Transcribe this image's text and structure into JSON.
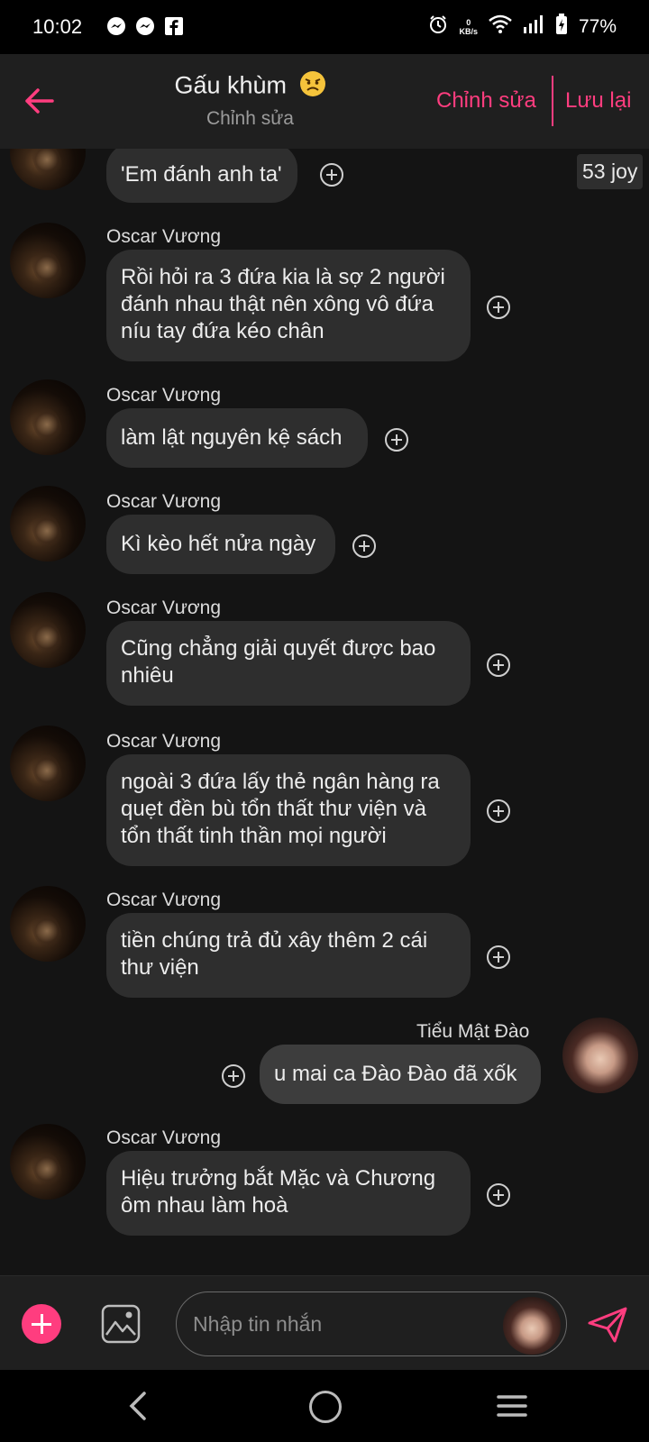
{
  "status_bar": {
    "time": "10:02",
    "net_speed_value": "0",
    "net_speed_unit": "KB/s",
    "battery": "77%",
    "notification_icons": [
      "messenger-icon",
      "messenger-icon",
      "facebook-icon"
    ]
  },
  "header": {
    "title": "Gấu khùm",
    "title_emoji": "angry-face-emoji",
    "subtitle": "Chỉnh sửa",
    "edit_label": "Chỉnh sửa",
    "save_label": "Lưu lại",
    "accent_color": "#ff3d7f"
  },
  "messages": [
    {
      "sender": "",
      "text": "'Em đánh anh ta'",
      "outgoing": false,
      "partial": true,
      "reaction": "53 joy"
    },
    {
      "sender": "Oscar Vương",
      "lines": [
        "Rồi hỏi ra 3 đứa kia là sợ 2 người",
        "đánh nhau thật nên xông vô đứa",
        "níu tay đứa kéo chân"
      ],
      "outgoing": false
    },
    {
      "sender": "Oscar Vương",
      "text": "làm lật nguyên kệ sách",
      "outgoing": false
    },
    {
      "sender": "Oscar Vương",
      "text": "Kì kèo hết nửa ngày",
      "outgoing": false
    },
    {
      "sender": "Oscar Vương",
      "lines": [
        "Cũng chẳng giải quyết được bao",
        "nhiêu"
      ],
      "outgoing": false
    },
    {
      "sender": "Oscar Vương",
      "lines": [
        "ngoài 3 đứa lấy thẻ ngân hàng ra",
        "quẹt đền bù tổn thất thư viện và",
        "tổn thất tinh thần mọi người"
      ],
      "outgoing": false
    },
    {
      "sender": "Oscar Vương",
      "lines": [
        "tiền chúng trả đủ xây thêm 2 cái",
        "thư viện"
      ],
      "outgoing": false
    },
    {
      "sender": "Tiểu Mật Đào",
      "text": "u mai ca Đào Đào đã xốk",
      "outgoing": true
    },
    {
      "sender": "Oscar Vương",
      "lines": [
        "Hiệu trưởng bắt Mặc và Chương",
        "ôm nhau làm hoà"
      ],
      "outgoing": false
    }
  ],
  "composer": {
    "placeholder": "Nhập tin nhắn"
  },
  "colors": {
    "background": "#141414",
    "bubble_incoming": "#2e2e2e",
    "bubble_outgoing": "#3d3d3d",
    "accent": "#ff3d7f"
  }
}
